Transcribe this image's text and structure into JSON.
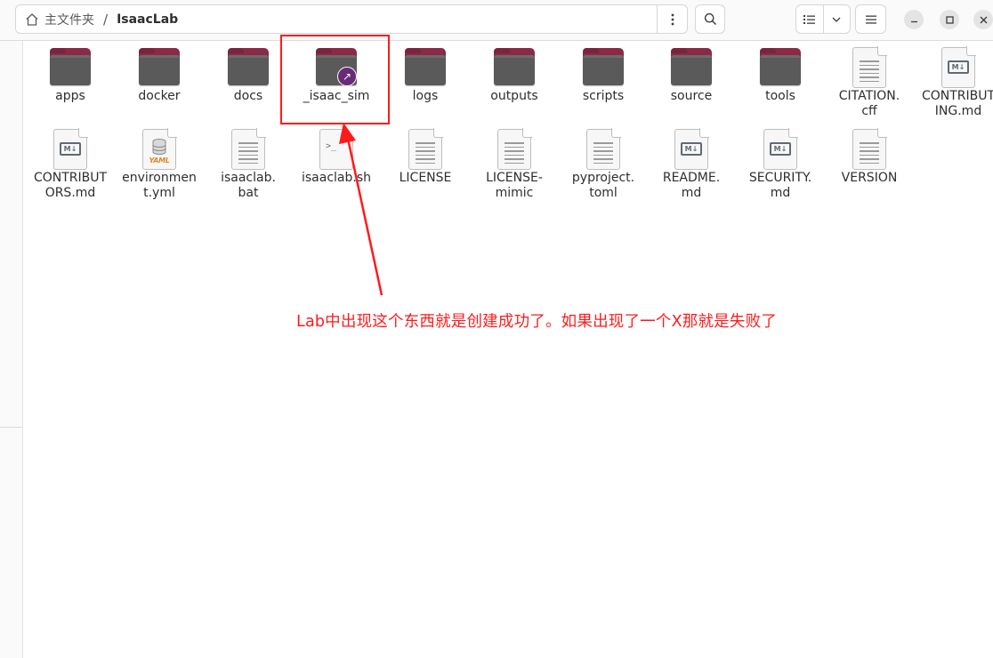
{
  "pathbar": {
    "home_label": "主文件夹",
    "separator": "/",
    "current_folder": "IsaacLab"
  },
  "toolbar": {
    "path_menu_icon": "vertical-dots-icon",
    "search_icon": "search-icon",
    "view_icon": "list-view-icon",
    "view_dropdown_icon": "chevron-down-icon",
    "main_menu_icon": "hamburger-menu-icon",
    "minimize_icon": "minimize-icon",
    "maximize_icon": "maximize-icon",
    "close_icon": "close-icon"
  },
  "items": [
    {
      "label": "apps",
      "type": "folder"
    },
    {
      "label": "docker",
      "type": "folder"
    },
    {
      "label": "docs",
      "type": "folder"
    },
    {
      "label": "_isaac_sim",
      "type": "folder-link"
    },
    {
      "label": "logs",
      "type": "folder"
    },
    {
      "label": "outputs",
      "type": "folder"
    },
    {
      "label": "scripts",
      "type": "folder"
    },
    {
      "label": "source",
      "type": "folder"
    },
    {
      "label": "tools",
      "type": "folder"
    },
    {
      "label": "CITATION.\ncff",
      "type": "text"
    },
    {
      "label": "CONTRIBUT\nING.md",
      "type": "markdown"
    },
    {
      "label": "CONTRIBUT\nORS.md",
      "type": "markdown"
    },
    {
      "label": "environmen\nt.yml",
      "type": "yaml"
    },
    {
      "label": "isaaclab.\nbat",
      "type": "text"
    },
    {
      "label": "isaaclab.sh",
      "type": "script"
    },
    {
      "label": "LICENSE",
      "type": "text"
    },
    {
      "label": "LICENSE-\nmimic",
      "type": "text"
    },
    {
      "label": "pyproject.\ntoml",
      "type": "text"
    },
    {
      "label": "README.\nmd",
      "type": "markdown"
    },
    {
      "label": "SECURITY.\nmd",
      "type": "markdown"
    },
    {
      "label": "VERSION",
      "type": "text"
    }
  ],
  "icon_text": {
    "markdown": "M↓",
    "yaml": "YAML",
    "script": ">_",
    "link": "↗"
  },
  "annotation": {
    "text": "Lab中出现这个东西就是创建成功了。如果出现了一个X那就是失败了",
    "color": "#ff1a1a"
  },
  "colors": {
    "folder_tab": "#8b2a48",
    "folder_body": "#5a5a5a",
    "link_badge": "#6a2a7a",
    "highlight": "#ff1a1a"
  }
}
